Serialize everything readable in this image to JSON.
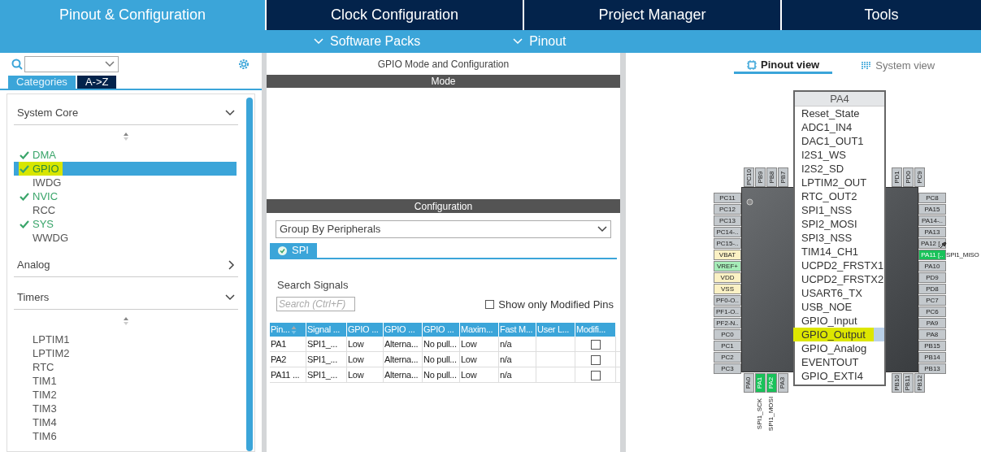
{
  "top_tabs": [
    {
      "label": "Pinout & Configuration",
      "selected": true
    },
    {
      "label": "Clock Configuration",
      "selected": false
    },
    {
      "label": "Project Manager",
      "selected": false
    },
    {
      "label": "Tools",
      "selected": false
    }
  ],
  "sub_menus": [
    "Software Packs",
    "Pinout"
  ],
  "left_panel": {
    "tabs": [
      {
        "label": "Categories",
        "selected": true
      },
      {
        "label": "A->Z",
        "selected": false
      }
    ],
    "sections": [
      {
        "title": "System Core",
        "expanded": true,
        "items": [
          {
            "label": "DMA",
            "enabled": true,
            "selected": false,
            "highlighted": false
          },
          {
            "label": "GPIO",
            "enabled": true,
            "selected": true,
            "highlighted": true
          },
          {
            "label": "IWDG",
            "enabled": false,
            "selected": false,
            "highlighted": false
          },
          {
            "label": "NVIC",
            "enabled": true,
            "selected": false,
            "highlighted": false
          },
          {
            "label": "RCC",
            "enabled": false,
            "selected": false,
            "highlighted": false
          },
          {
            "label": "SYS",
            "enabled": true,
            "selected": false,
            "highlighted": false
          },
          {
            "label": "WWDG",
            "enabled": false,
            "selected": false,
            "highlighted": false
          }
        ]
      },
      {
        "title": "Analog",
        "expanded": false
      },
      {
        "title": "Timers",
        "expanded": true,
        "items": [
          {
            "label": "LPTIM1",
            "enabled": false,
            "selected": false,
            "highlighted": false
          },
          {
            "label": "LPTIM2",
            "enabled": false,
            "selected": false,
            "highlighted": false
          },
          {
            "label": "RTC",
            "enabled": false,
            "selected": false,
            "highlighted": false
          },
          {
            "label": "TIM1",
            "enabled": false,
            "selected": false,
            "highlighted": false
          },
          {
            "label": "TIM2",
            "enabled": false,
            "selected": false,
            "highlighted": false
          },
          {
            "label": "TIM3",
            "enabled": false,
            "selected": false,
            "highlighted": false
          },
          {
            "label": "TIM4",
            "enabled": false,
            "selected": false,
            "highlighted": false
          },
          {
            "label": "TIM6",
            "enabled": false,
            "selected": false,
            "highlighted": false
          }
        ]
      }
    ]
  },
  "middle": {
    "title": "GPIO Mode and Configuration",
    "mode_header": "Mode",
    "config_header": "Configuration",
    "group_select": "Group By Peripherals",
    "tabs": [
      {
        "label": "SPI",
        "selected": true
      }
    ],
    "search_label": "Search Signals",
    "search": {
      "placeholder": "Search (Ctrl+F)"
    },
    "modified_only": {
      "label": "Show only Modified Pins",
      "checked": false
    },
    "table": {
      "columns": [
        "Pin...",
        "Signal ...",
        "GPIO ...",
        "GPIO ...",
        "GPIO ...",
        "Maxim...",
        "Fast M...",
        "User L...",
        "Modifi..."
      ],
      "rows": [
        {
          "cells": [
            "PA1",
            "SPI1_...",
            "Low",
            "Alterna...",
            "No pull...",
            "Low",
            "n/a"
          ],
          "modified": false
        },
        {
          "cells": [
            "PA2",
            "SPI1_...",
            "Low",
            "Alterna...",
            "No pull...",
            "Low",
            "n/a"
          ],
          "modified": false
        },
        {
          "cells": [
            "PA11 ...",
            "SPI1_...",
            "Low",
            "Alterna...",
            "No pull...",
            "Low",
            "n/a"
          ],
          "modified": false
        }
      ]
    }
  },
  "right": {
    "view_tabs": [
      {
        "label": "Pinout view",
        "selected": true
      },
      {
        "label": "System view",
        "selected": false
      }
    ],
    "chip": {
      "left_pins": [
        {
          "name": "PC11",
          "kind": "io"
        },
        {
          "name": "PC12",
          "kind": "io"
        },
        {
          "name": "PC13",
          "kind": "io"
        },
        {
          "name": "PC14-..",
          "kind": "io"
        },
        {
          "name": "PC15-..",
          "kind": "io"
        },
        {
          "name": "VBAT",
          "kind": "power"
        },
        {
          "name": "VREF+",
          "kind": "vref"
        },
        {
          "name": "VDD",
          "kind": "power"
        },
        {
          "name": "VSS",
          "kind": "power"
        },
        {
          "name": "PF0-O..",
          "kind": "io"
        },
        {
          "name": "PF1-O..",
          "kind": "io"
        },
        {
          "name": "PF2-N..",
          "kind": "io"
        },
        {
          "name": "PC0",
          "kind": "io"
        },
        {
          "name": "PC1",
          "kind": "io"
        },
        {
          "name": "PC2",
          "kind": "io"
        },
        {
          "name": "PC3",
          "kind": "io"
        }
      ],
      "right_pins": [
        {
          "name": "PC8",
          "kind": "io"
        },
        {
          "name": "PA15",
          "kind": "io"
        },
        {
          "name": "PA14-..",
          "kind": "io"
        },
        {
          "name": "PA13",
          "kind": "io"
        },
        {
          "name": "PA12 [..",
          "kind": "io"
        },
        {
          "name": "PA11 [..",
          "kind": "assigned",
          "signal": "SPI1_MISO"
        },
        {
          "name": "PA10",
          "kind": "io"
        },
        {
          "name": "PD9",
          "kind": "io"
        },
        {
          "name": "PD8",
          "kind": "io"
        },
        {
          "name": "PC7",
          "kind": "io"
        },
        {
          "name": "PC6",
          "kind": "io"
        },
        {
          "name": "PA9",
          "kind": "io"
        },
        {
          "name": "PA8",
          "kind": "io"
        },
        {
          "name": "PB15",
          "kind": "io"
        },
        {
          "name": "PB14",
          "kind": "io"
        },
        {
          "name": "PB13",
          "kind": "io"
        }
      ],
      "top_pins_left": [
        {
          "name": "PC10",
          "kind": "io"
        },
        {
          "name": "PB9",
          "kind": "io"
        },
        {
          "name": "PB8",
          "kind": "io"
        },
        {
          "name": "PB7",
          "kind": "io"
        }
      ],
      "top_pins_right": [
        {
          "name": "PD1",
          "kind": "io"
        },
        {
          "name": "PD0",
          "kind": "io"
        },
        {
          "name": "PC9",
          "kind": "io"
        }
      ],
      "bottom_pins_left": [
        {
          "name": "PA0",
          "kind": "io"
        },
        {
          "name": "PA1",
          "kind": "assigned",
          "signal": "SPI1_SCK"
        },
        {
          "name": "PA2",
          "kind": "assigned",
          "signal": "SPI1_MOSI"
        },
        {
          "name": "PA3",
          "kind": "io"
        }
      ],
      "bottom_pins_right": [
        {
          "name": "PB10",
          "kind": "io"
        },
        {
          "name": "PB11",
          "kind": "io"
        },
        {
          "name": "PB12",
          "kind": "io"
        }
      ]
    },
    "pin_menu": {
      "title": "PA4",
      "items": [
        {
          "label": "Reset_State",
          "selected": false,
          "highlighted": false
        },
        {
          "label": "ADC1_IN4",
          "selected": false,
          "highlighted": false
        },
        {
          "label": "DAC1_OUT1",
          "selected": false,
          "highlighted": false
        },
        {
          "label": "I2S1_WS",
          "selected": false,
          "highlighted": false
        },
        {
          "label": "I2S2_SD",
          "selected": false,
          "highlighted": false
        },
        {
          "label": "LPTIM2_OUT",
          "selected": false,
          "highlighted": false
        },
        {
          "label": "RTC_OUT2",
          "selected": false,
          "highlighted": false
        },
        {
          "label": "SPI1_NSS",
          "selected": false,
          "highlighted": false
        },
        {
          "label": "SPI2_MOSI",
          "selected": false,
          "highlighted": false
        },
        {
          "label": "SPI3_NSS",
          "selected": false,
          "highlighted": false
        },
        {
          "label": "TIM14_CH1",
          "selected": false,
          "highlighted": false
        },
        {
          "label": "UCPD2_FRSTX1",
          "selected": false,
          "highlighted": false
        },
        {
          "label": "UCPD2_FRSTX2",
          "selected": false,
          "highlighted": false
        },
        {
          "label": "USART6_TX",
          "selected": false,
          "highlighted": false
        },
        {
          "label": "USB_NOE",
          "selected": false,
          "highlighted": false
        },
        {
          "label": "GPIO_Input",
          "selected": false,
          "highlighted": false
        },
        {
          "label": "GPIO_Output",
          "selected": true,
          "highlighted": true
        },
        {
          "label": "GPIO_Analog",
          "selected": false,
          "highlighted": false
        },
        {
          "label": "EVENTOUT",
          "selected": false,
          "highlighted": false
        },
        {
          "label": "GPIO_EXTI4",
          "selected": false,
          "highlighted": false
        }
      ]
    }
  }
}
